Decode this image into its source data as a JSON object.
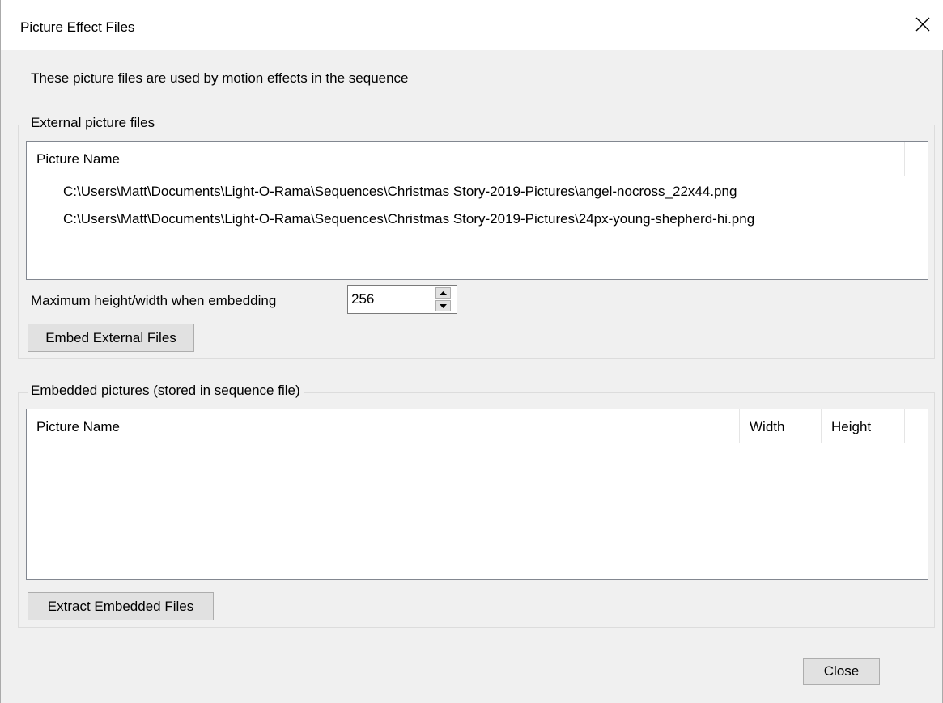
{
  "window": {
    "title": "Picture Effect Files"
  },
  "intro_text": "These picture files are used by motion effects in the sequence",
  "external_group": {
    "label": "External picture files",
    "columns": [
      "Picture Name"
    ],
    "rows": [
      "C:\\Users\\Matt\\Documents\\Light-O-Rama\\Sequences\\Christmas Story-2019-Pictures\\angel-nocross_22x44.png",
      "C:\\Users\\Matt\\Documents\\Light-O-Rama\\Sequences\\Christmas Story-2019-Pictures\\24px-young-shepherd-hi.png"
    ],
    "max_size_label": "Maximum height/width when embedding",
    "max_size_value": "256",
    "embed_button": "Embed External Files"
  },
  "embedded_group": {
    "label": "Embedded pictures (stored in sequence file)",
    "columns": [
      "Picture Name",
      "Width",
      "Height"
    ],
    "rows": [],
    "extract_button": "Extract Embedded Files"
  },
  "close_button": "Close",
  "icons": {
    "close": "close-icon",
    "spin_up": "up-arrow-icon",
    "spin_down": "down-arrow-icon"
  }
}
